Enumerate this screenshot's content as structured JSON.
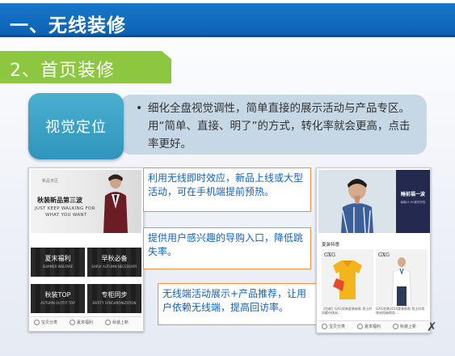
{
  "slide": {
    "title": "一、无线装修",
    "subtitle": "2、首页装修",
    "badge": "视觉定位",
    "bullet": "•",
    "description": "细化全盘视觉调性，简单直接的展示活动与产品专区。用“简单、直接、明了”的方式，转化率就会更高，点击率更好。"
  },
  "callouts": [
    "利用无线即时效应，新品上线或大型活动，可在手机端提前预热。",
    "提供用户感兴趣的导购入口，降低跳失率。",
    "无线端活动展示+产品推荐，让用户依赖无线端，提高回访率。"
  ],
  "left_phone": {
    "banner_small": "新品专区",
    "banner_main": "秋装新品第三波",
    "banner_en1": "JUST KEEP WALKING FOR",
    "banner_en2": "WHAT YOU WANT",
    "tiles": [
      {
        "cn": "夏末福利",
        "en": "SUMMER WELFARE"
      },
      {
        "cn": "早秋必备",
        "en": "EARLY AUTUMN NECESSARY"
      },
      {
        "cn": "秋装TOP",
        "en": "AUTUMN OUTFIT TOP"
      },
      {
        "cn": "专柜同步",
        "en": "ENTITY SYNCHRONIZATION"
      }
    ],
    "tabs": [
      "宝贝分类",
      "夏末福利",
      "秋装上新"
    ]
  },
  "right_phone": {
    "promo": "睡前福一波",
    "promo_sub": "每晚21:00准时开抢",
    "section": "夏装特惠",
    "products": [
      {
        "brand": "GXG",
        "caption": "【包邮】GXG男装夏装新款 男士时尚都市休闲...",
        "price": "¥"
      },
      {
        "brand": "GXG",
        "caption": "GXG男装2014夏装新款 男士时尚休闲短袖商务...",
        "price": "¥"
      }
    ],
    "tabs": [
      "宝贝分类",
      "夏末福利",
      "秋装上新"
    ]
  },
  "colors": {
    "title_bar": "#0c62b4",
    "subtitle_bar": "#8dc63f",
    "badge": "#3aa2c6",
    "desc_panel": "#c6d7e6",
    "callout_border": "#f0913a",
    "callout_text": "#1462b6"
  },
  "icons": [
    "category-icon",
    "gift-icon",
    "new-icon"
  ]
}
